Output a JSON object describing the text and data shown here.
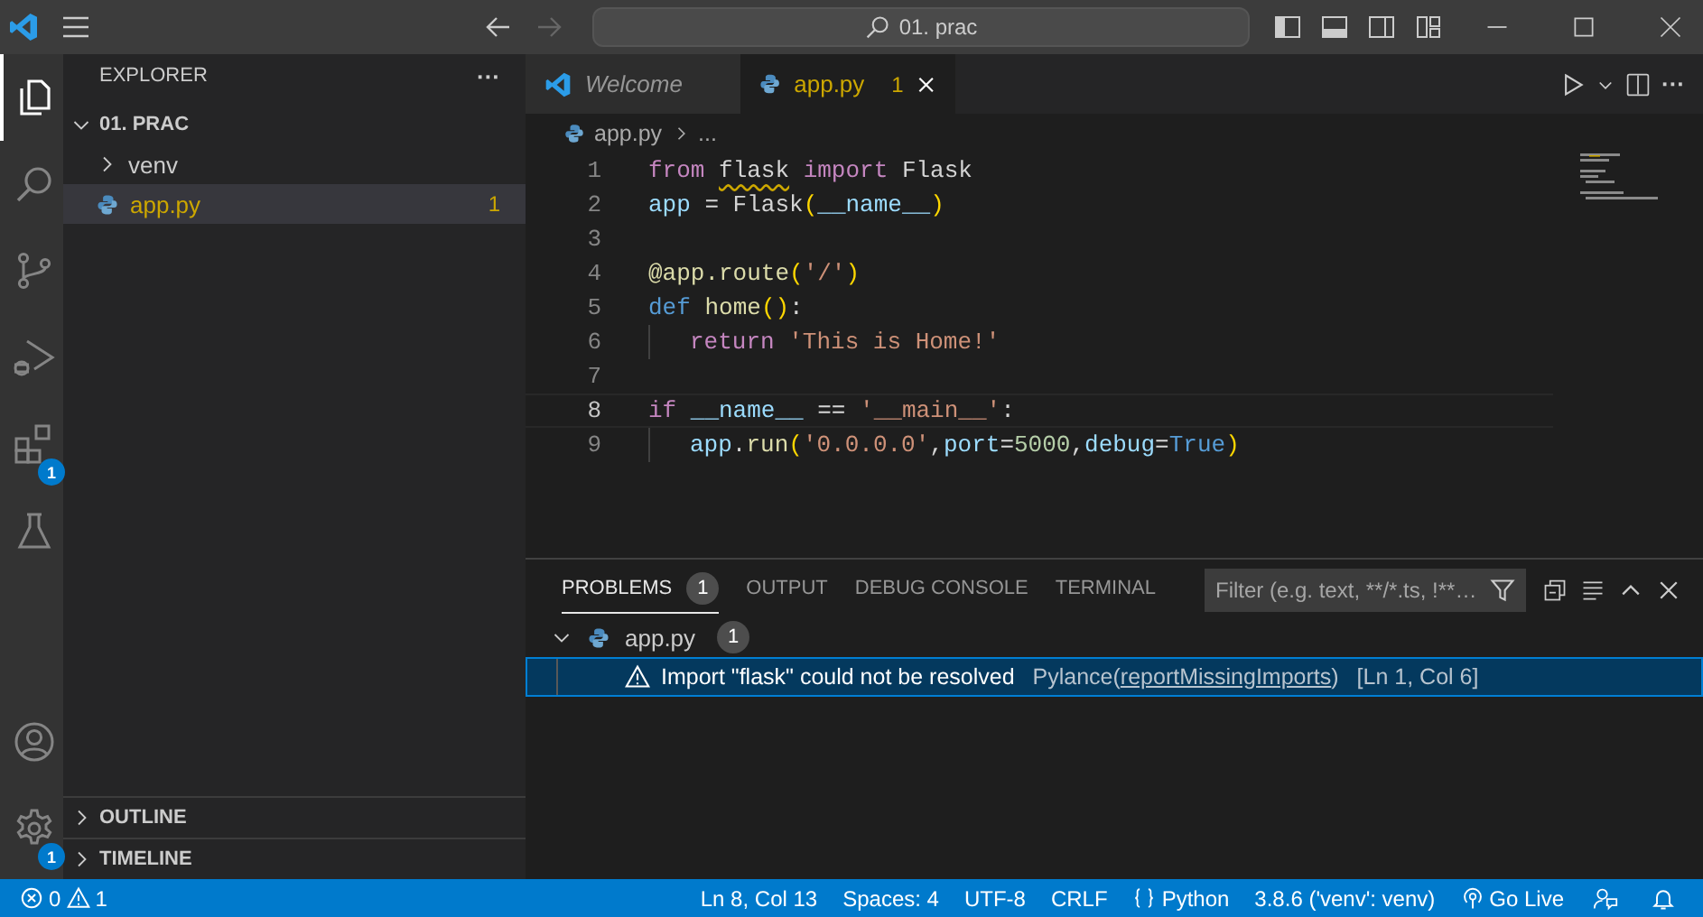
{
  "title_bar": {
    "search": "01. prac",
    "back_disabled": false,
    "forward_disabled": true
  },
  "activity_bar": {
    "items": [
      {
        "kind": "explorer",
        "selected": true
      },
      {
        "kind": "search",
        "selected": false
      },
      {
        "kind": "source-control",
        "selected": false
      },
      {
        "kind": "run-debug",
        "selected": false
      },
      {
        "kind": "extensions",
        "selected": false,
        "badge": "1"
      },
      {
        "kind": "testing",
        "selected": false
      }
    ],
    "bottom": [
      {
        "kind": "account",
        "selected": false
      },
      {
        "kind": "settings",
        "selected": false,
        "badge": "1"
      }
    ]
  },
  "sidebar": {
    "title": "EXPLORER",
    "more": "···",
    "folder": {
      "label": "01. PRAC",
      "expanded": true
    },
    "items": [
      {
        "kind": "folder",
        "label": "venv",
        "expanded": false,
        "selected": false,
        "warning": false
      },
      {
        "kind": "python",
        "label": "app.py",
        "selected": true,
        "badge": "1",
        "warning": true
      }
    ],
    "sections": [
      {
        "label": "OUTLINE",
        "expanded": false
      },
      {
        "label": "TIMELINE",
        "expanded": false
      }
    ]
  },
  "editor": {
    "tabs": [
      {
        "kind": "welcome",
        "label": "Welcome",
        "selected": false,
        "italic": true,
        "warning": false
      },
      {
        "kind": "python",
        "label": "app.py",
        "selected": true,
        "badge": "1",
        "warning": true,
        "italic": false
      }
    ],
    "more": "···",
    "breadcrumb": [
      "app.py",
      "..."
    ],
    "lines": [
      {
        "number": "1",
        "current": false,
        "tokens": [
          {
            "text": "from ",
            "kind": "keyword"
          },
          {
            "text": "flask",
            "kind": "plain",
            "squiggle": true
          },
          {
            "text": " import",
            "kind": "keyword"
          },
          {
            "text": " Flask",
            "kind": "plain"
          }
        ]
      },
      {
        "number": "2",
        "current": false,
        "tokens": [
          {
            "text": "app",
            "kind": "variable"
          },
          {
            "text": " = Flask",
            "kind": "plain"
          },
          {
            "text": "(",
            "kind": "bracket"
          },
          {
            "text": "__name__",
            "kind": "variable"
          },
          {
            "text": ")",
            "kind": "bracket"
          }
        ]
      },
      {
        "number": "3",
        "current": false
      },
      {
        "number": "4",
        "current": false,
        "tokens": [
          {
            "text": "@app.route",
            "kind": "function"
          },
          {
            "text": "(",
            "kind": "bracket"
          },
          {
            "text": "'/'",
            "kind": "string"
          },
          {
            "text": ")",
            "kind": "bracket"
          }
        ]
      },
      {
        "number": "5",
        "current": false,
        "tokens": [
          {
            "text": "def ",
            "kind": "storage"
          },
          {
            "text": "home",
            "kind": "function"
          },
          {
            "text": "()",
            "kind": "bracket"
          },
          {
            "text": ":",
            "kind": "plain"
          }
        ]
      },
      {
        "number": "6",
        "current": false,
        "indent": true,
        "tokens": [
          {
            "text": "return ",
            "kind": "keyword"
          },
          {
            "text": "'This is Home!'",
            "kind": "string"
          }
        ]
      },
      {
        "number": "7",
        "current": false
      },
      {
        "number": "8",
        "current": true,
        "tokens": [
          {
            "text": "if ",
            "kind": "keyword"
          },
          {
            "text": "__name__",
            "kind": "variable"
          },
          {
            "text": " == ",
            "kind": "plain"
          },
          {
            "text": "'__main__'",
            "kind": "string"
          },
          {
            "text": ":",
            "kind": "plain"
          }
        ]
      },
      {
        "number": "9",
        "current": false,
        "indent": true,
        "tokens": [
          {
            "text": "app",
            "kind": "variable"
          },
          {
            "text": ".",
            "kind": "plain"
          },
          {
            "text": "run",
            "kind": "function"
          },
          {
            "text": "(",
            "kind": "bracket"
          },
          {
            "text": "'0.0.0.0'",
            "kind": "string"
          },
          {
            "text": ",",
            "kind": "plain"
          },
          {
            "text": "port",
            "kind": "variable"
          },
          {
            "text": "=",
            "kind": "plain"
          },
          {
            "text": "5000",
            "kind": "number"
          },
          {
            "text": ",",
            "kind": "plain"
          },
          {
            "text": "debug",
            "kind": "variable"
          },
          {
            "text": "=",
            "kind": "plain"
          },
          {
            "text": "True",
            "kind": "storage"
          },
          {
            "text": ")",
            "kind": "bracket"
          }
        ]
      }
    ]
  },
  "panel": {
    "tabs": [
      {
        "label": "PROBLEMS",
        "badge": "1",
        "selected": true
      },
      {
        "label": "OUTPUT",
        "selected": false
      },
      {
        "label": "DEBUG CONSOLE",
        "selected": false
      },
      {
        "label": "TERMINAL",
        "selected": false
      }
    ],
    "filter_placeholder": "Filter (e.g. text, **/*.ts, !**…",
    "problems": [
      {
        "file": "app.py",
        "count": "1",
        "expanded": true,
        "items": [
          {
            "kind": "warning",
            "message": "Import \"flask\" could not be resolved",
            "source": "Pylance(",
            "code": "reportMissingImports",
            "source_end": ")",
            "location": "[Ln 1, Col 6]",
            "selected": true
          }
        ]
      }
    ]
  },
  "status_bar": {
    "errors": "0",
    "warnings": "1",
    "items": [
      {
        "kind": "text",
        "text": "Ln 8, Col 13"
      },
      {
        "kind": "text",
        "text": "Spaces: 4"
      },
      {
        "kind": "text",
        "text": "UTF-8"
      },
      {
        "kind": "text",
        "text": "CRLF"
      },
      {
        "kind": "language",
        "text": "Python"
      },
      {
        "kind": "text",
        "text": "3.8.6 ('venv': venv)"
      },
      {
        "kind": "golive",
        "text": "Go Live"
      },
      {
        "kind": "feedback"
      },
      {
        "kind": "bell"
      }
    ]
  }
}
